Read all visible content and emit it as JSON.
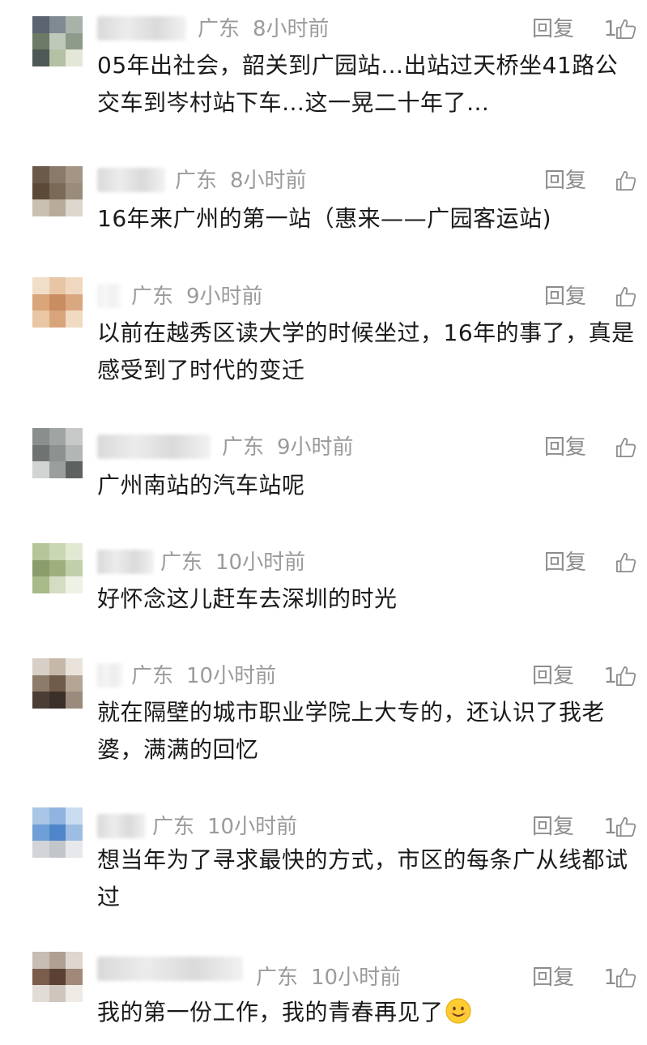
{
  "comments": [
    {
      "location": "广东",
      "time": "8小时前",
      "reply_label": "回复",
      "likes": "1",
      "text": "05年出社会，韶关到广园站…出站过天桥坐41路公交车到岑村站下车…这一晃二十年了…"
    },
    {
      "location": "广东",
      "time": "8小时前",
      "reply_label": "回复",
      "likes": "",
      "text": "16年来广州的第一站（惠来——广园客运站)"
    },
    {
      "location": "广东",
      "time": "9小时前",
      "reply_label": "回复",
      "likes": "",
      "text": "以前在越秀区读大学的时候坐过，16年的事了，真是感受到了时代的变迁"
    },
    {
      "location": "广东",
      "time": "9小时前",
      "reply_label": "回复",
      "likes": "",
      "text": "广州南站的汽车站呢"
    },
    {
      "location": "广东",
      "time": "10小时前",
      "reply_label": "回复",
      "likes": "",
      "text": "好怀念这儿赶车去深圳的时光"
    },
    {
      "location": "广东",
      "time": "10小时前",
      "reply_label": "回复",
      "likes": "1",
      "text": "就在隔壁的城市职业学院上大专的，还认识了我老婆，满满的回忆"
    },
    {
      "location": "广东",
      "time": "10小时前",
      "reply_label": "回复",
      "likes": "1",
      "text": "想当年为了寻求最快的方式，市区的每条广从线都试过"
    },
    {
      "location": "广东",
      "time": "10小时前",
      "reply_label": "回复",
      "likes": "1",
      "text": "我的第一份工作，我的青春再见了"
    }
  ],
  "icons": {
    "like": "thumbs-up-icon",
    "emoji": "smile-emoji-icon"
  },
  "colors": {
    "meta_text": "#9b9b9b",
    "body_text": "#1a1a1a",
    "background": "#ffffff"
  }
}
